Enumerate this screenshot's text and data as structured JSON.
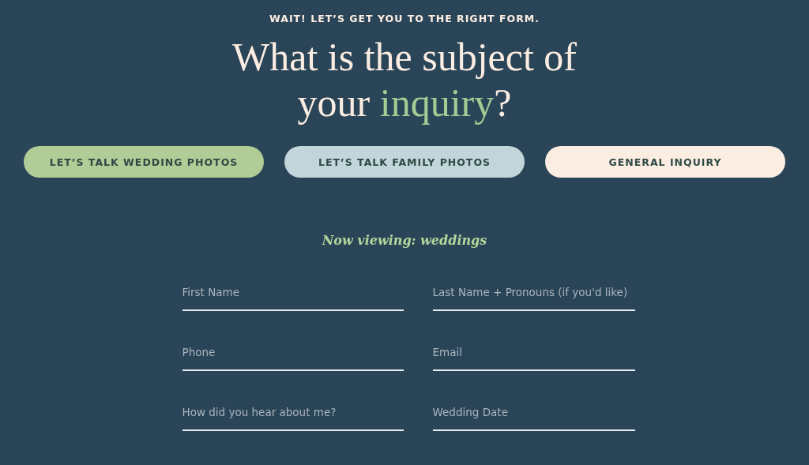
{
  "eyebrow": "WAIT! LET’S GET YOU TO THE RIGHT FORM.",
  "heading": {
    "before": "What is the subject of your ",
    "highlight": "inquiry",
    "after": "?"
  },
  "options": [
    {
      "label": "LET’S TALK WEDDING PHOTOS",
      "color": "#b1cc96"
    },
    {
      "label": "LET’S TALK FAMILY PHOTOS",
      "color": "#c1d5da"
    },
    {
      "label": "GENERAL INQUIRY",
      "color": "#fcede2"
    }
  ],
  "viewing": "Now viewing: weddings",
  "fields": [
    {
      "placeholder": "First Name"
    },
    {
      "placeholder": "Last Name + Pronouns (if you'd like)"
    },
    {
      "placeholder": "Phone"
    },
    {
      "placeholder": "Email"
    },
    {
      "placeholder": "How did you hear about me?"
    },
    {
      "placeholder": "Wedding Date"
    }
  ]
}
